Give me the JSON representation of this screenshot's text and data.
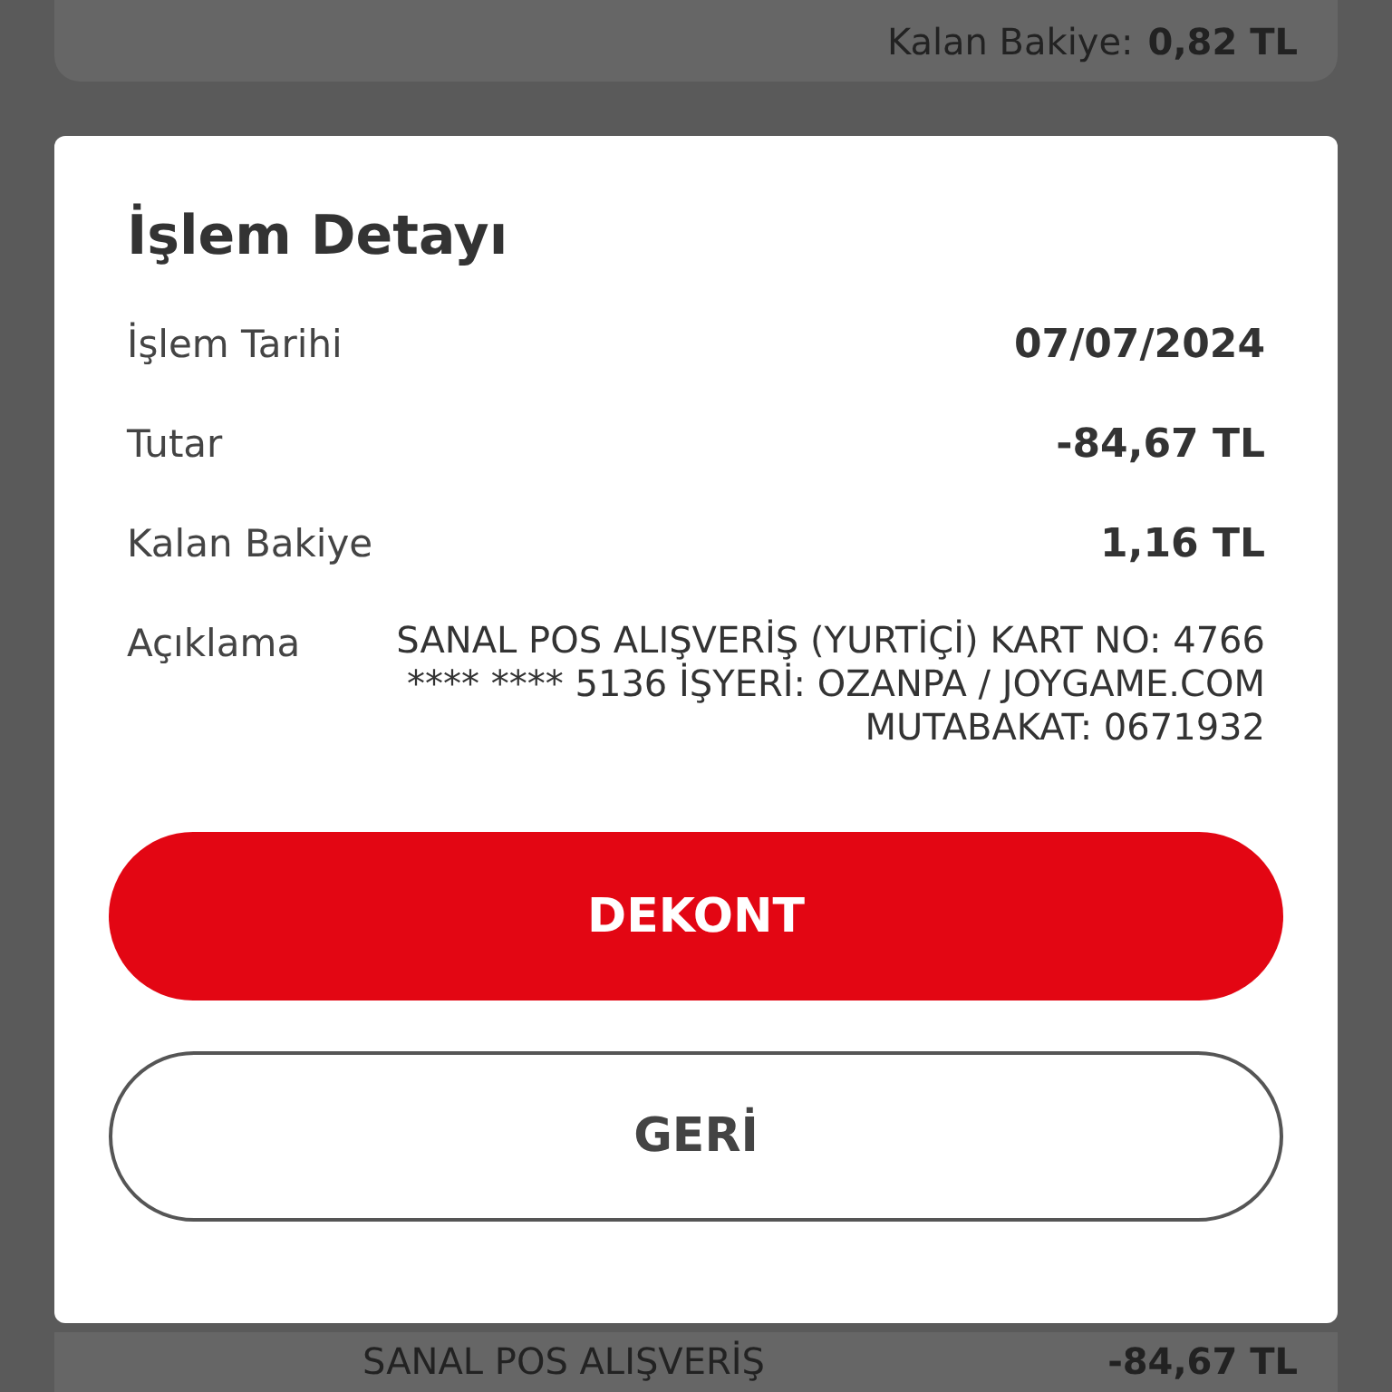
{
  "background": {
    "top_card": {
      "label": "Kalan Bakiye:",
      "value": "0,82 TL"
    },
    "bottom_card": {
      "description": "SANAL POS ALIŞVERİŞ",
      "amount": "-84,67 TL"
    }
  },
  "dialog": {
    "title": "İşlem Detayı",
    "rows": [
      {
        "label": "İşlem Tarihi",
        "value": "07/07/2024",
        "kind": "bold"
      },
      {
        "label": "Tutar",
        "value": "-84,67 TL",
        "kind": "bold"
      },
      {
        "label": "Kalan Bakiye",
        "value": "1,16 TL",
        "kind": "bold"
      },
      {
        "label": "Açıklama",
        "value": "SANAL POS ALIŞVERİŞ (YURTİÇİ) KART NO: 4766 **** **** 5136 İŞYERİ: OZANPA / JOYGAME.COM MUTABAKAT: 0671932",
        "kind": "plain"
      }
    ],
    "buttons": [
      {
        "label": "DEKONT",
        "kind": "primary"
      },
      {
        "label": "GERİ",
        "kind": "secondary"
      }
    ]
  }
}
